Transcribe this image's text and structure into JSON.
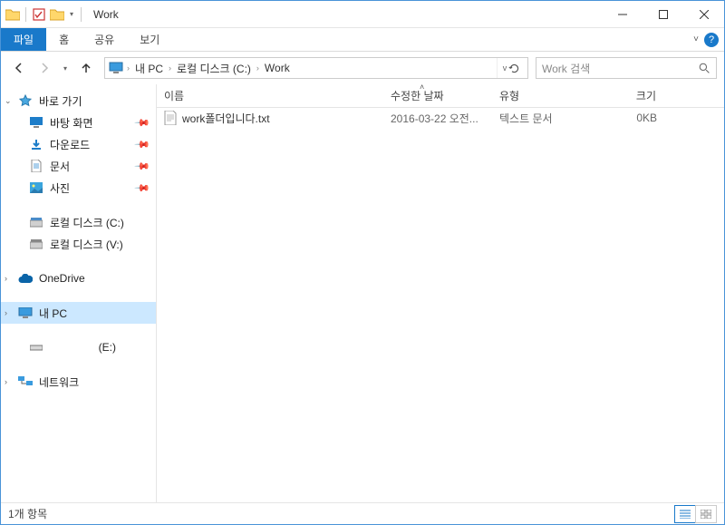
{
  "window": {
    "title": "Work"
  },
  "ribbon": {
    "file": "파일",
    "tabs": [
      "홈",
      "공유",
      "보기"
    ]
  },
  "breadcrumb": {
    "items": [
      "내 PC",
      "로컬 디스크 (C:)",
      "Work"
    ]
  },
  "search": {
    "placeholder": "Work 검색"
  },
  "sidebar": {
    "quick": {
      "label": "바로 가기",
      "items": [
        {
          "label": "바탕 화면",
          "pinned": true
        },
        {
          "label": "다운로드",
          "pinned": true
        },
        {
          "label": "문서",
          "pinned": true
        },
        {
          "label": "사진",
          "pinned": true
        }
      ]
    },
    "drives": [
      {
        "label": "로컬 디스크 (C:)"
      },
      {
        "label": "로컬 디스크 (V:)"
      }
    ],
    "onedrive": "OneDrive",
    "thispc": "내 PC",
    "removable": "(E:)",
    "network": "네트워크"
  },
  "columns": {
    "name": "이름",
    "date": "수정한 날짜",
    "type": "유형",
    "size": "크기"
  },
  "files": [
    {
      "name": "work폴더입니다.txt",
      "date": "2016-03-22 오전...",
      "type": "텍스트 문서",
      "size": "0KB"
    }
  ],
  "status": {
    "count": "1개 항목"
  }
}
